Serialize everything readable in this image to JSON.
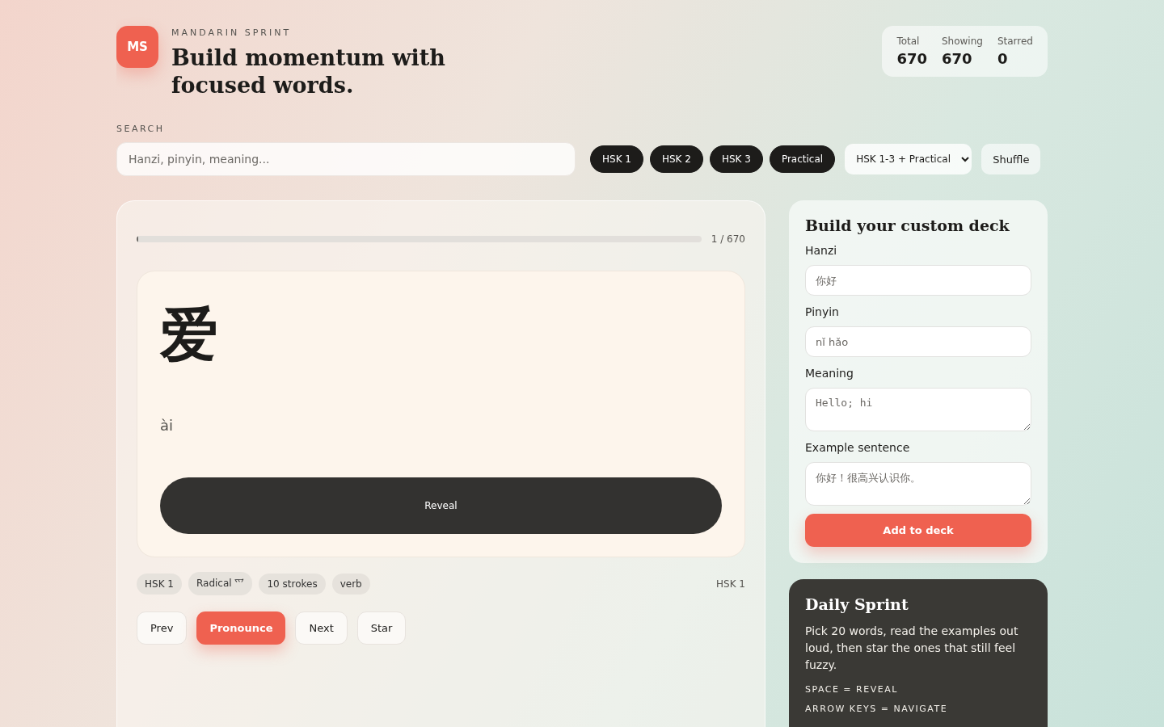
{
  "brand": {
    "logo": "MS",
    "eyebrow": "MANDARIN SPRINT",
    "title": "Build momentum with focused words."
  },
  "stats": [
    {
      "label": "Total",
      "value": "670"
    },
    {
      "label": "Showing",
      "value": "670"
    },
    {
      "label": "Starred",
      "value": "0"
    }
  ],
  "search": {
    "label": "SEARCH",
    "placeholder": "Hanzi, pinyin, meaning..."
  },
  "filters": [
    {
      "label": "HSK 1",
      "selected": true
    },
    {
      "label": "HSK 2",
      "selected": true
    },
    {
      "label": "HSK 3",
      "selected": true
    },
    {
      "label": "Practical",
      "selected": true
    }
  ],
  "deck_select": {
    "value": "HSK 1-3 + Practical"
  },
  "shuffle_button": "Shuffle",
  "card": {
    "progress": {
      "level": 0.0015,
      "reading": "1 / 670"
    },
    "hanzi": "爱",
    "pinyin": "ài",
    "reveal_button": "Reveal",
    "tags": [
      {
        "label": "HSK 1"
      },
      {
        "label": "Radical 爫"
      },
      {
        "label": "10 strokes"
      },
      {
        "label": "verb"
      }
    ],
    "level_label": "HSK 1",
    "actions": [
      {
        "label": "Prev",
        "kind": "plain"
      },
      {
        "label": "Pronounce",
        "kind": "primary"
      },
      {
        "label": "Next",
        "kind": "plain"
      },
      {
        "label": "Star",
        "kind": "plain"
      }
    ]
  },
  "custom_deck": {
    "title": "Build your custom deck",
    "fields": [
      {
        "label": "Hanzi",
        "placeholder": "你好",
        "kind": "input"
      },
      {
        "label": "Pinyin",
        "placeholder": "nǐ hǎo",
        "kind": "input"
      },
      {
        "label": "Meaning",
        "placeholder": "Hello; hi",
        "kind": "textarea"
      },
      {
        "label": "Example sentence",
        "placeholder": "你好！很高兴认识你。",
        "kind": "textarea"
      }
    ],
    "submit": "Add to deck"
  },
  "daily_sprint": {
    "title": "Daily Sprint",
    "text": "Pick 20 words, read the examples out loud, then star the ones that still feel fuzzy.",
    "shortcuts": [
      "SPACE = REVEAL",
      "ARROW KEYS = NAVIGATE"
    ]
  }
}
